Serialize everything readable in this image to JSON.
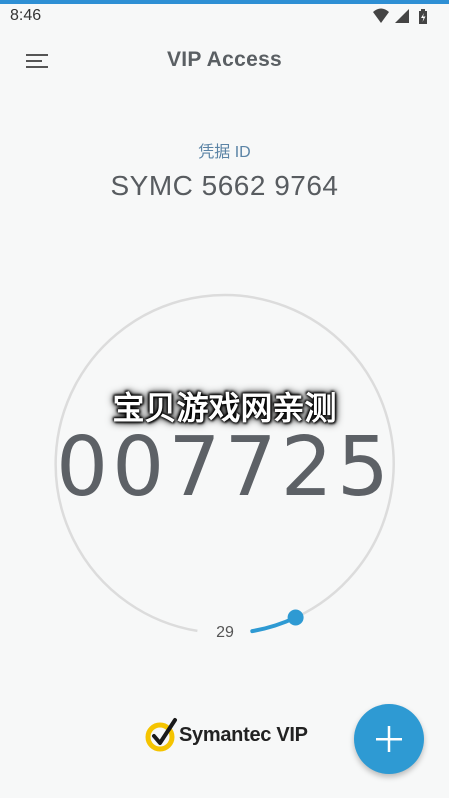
{
  "status_bar": {
    "time": "8:46",
    "icons": [
      "wifi-icon",
      "signal-icon",
      "battery-icon"
    ]
  },
  "app_bar": {
    "title": "VIP Access",
    "menu_icon": "hamburger-menu-icon"
  },
  "credential": {
    "label": "凭据 ID",
    "id": "SYMC 5662 9764"
  },
  "security_code": {
    "overlay_text": "宝贝游戏网亲测",
    "code": "007725",
    "seconds_remaining": "29",
    "progress_fraction": 0.1
  },
  "footer": {
    "brand": "Symantec",
    "product": "VIP",
    "brand_icon": "symantec-check-logo"
  },
  "fab": {
    "icon": "plus-icon"
  },
  "colors": {
    "accent": "#2e9ad3",
    "ring": "#dcdcdc",
    "label": "#5b84a6",
    "logo_yellow": "#f5c400"
  }
}
